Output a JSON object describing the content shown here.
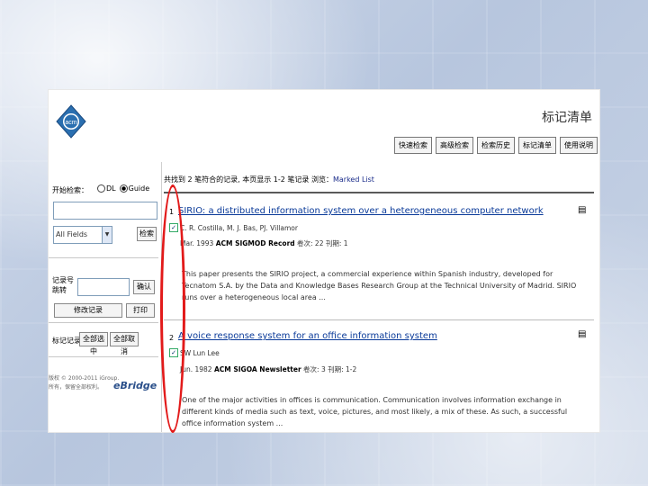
{
  "header": {
    "title": "标记清单",
    "toolbar": [
      "快速检索",
      "高级检索",
      "检索历史",
      "标记清单",
      "使用说明"
    ],
    "logo_text": "acm"
  },
  "sidebar": {
    "search_label": "开始检索：",
    "radio_dl": "DL",
    "radio_guide": "Guide",
    "field_select": "All Fields",
    "search_button": "检索",
    "record_no_label": "记录号",
    "record_no_label2": "跳转",
    "confirm_button": "确认",
    "btn_reprint": "修改记录",
    "btn_print": "打印",
    "marked_label": "标记记录",
    "btn_mark_all": "全部选中",
    "btn_clear_all": "全部取消",
    "copyright_line1": "版权 © 2000-2011 iGroup.",
    "copyright_line2": "所有，保留全部权利。",
    "ebridge": "eBridge"
  },
  "results": {
    "summary_prefix": "共找到 2 笔符合的记录, 本页显示 1-2 笔记录 浏览：",
    "summary_hl": "Marked List",
    "items": [
      {
        "num": "1",
        "title": "SIRIO: a distributed information system over a heterogeneous computer network",
        "authors": "C. R. Costilla,  M. J. Bas,  PJ. Villamor",
        "meta_prefix": "Mar. 1993  ",
        "meta_pub": "ACM SIGMOD Record",
        "meta_suffix": "  卷次: 22 刊期: 1",
        "abstract": "This paper presents the SIRIO project, a commercial experience within Spanish industry, developed for Tecnatom S.A. by the Data and Knowledge Bases Research Group at the Technical University of Madrid. SIRIO runs over a heterogeneous local area ..."
      },
      {
        "num": "2",
        "title": "A voice response system for an office information system",
        "authors": "SW Lun Lee",
        "meta_prefix": "Jun. 1982  ",
        "meta_pub": "ACM SIGOA Newsletter",
        "meta_suffix": "  卷次: 3 刊期: 1-2",
        "abstract": "One of the major activities in offices is communication. Communication involves information exchange in different kinds of media such as text, voice, pictures, and most likely, a mix of these. As such, a successful office information system ..."
      }
    ]
  },
  "colors": {
    "link": "#0a3a99",
    "highlight_oval": "#e21a1a"
  }
}
